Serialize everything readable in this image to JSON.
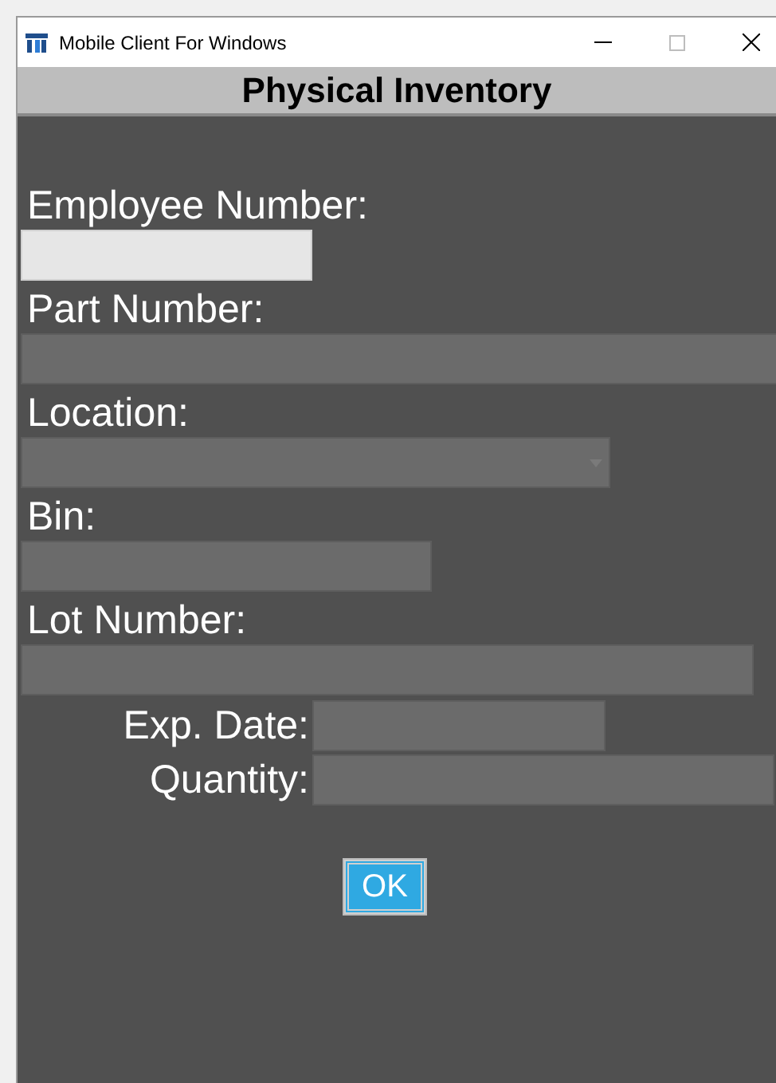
{
  "window": {
    "title": "Mobile Client For Windows"
  },
  "header": {
    "title": "Physical Inventory"
  },
  "fields": [
    {
      "label": "Employee Number:",
      "kind": "text",
      "disabled": false
    },
    {
      "label": "Part Number:",
      "kind": "text",
      "disabled": true
    },
    {
      "label": "Location:",
      "kind": "dropdown",
      "disabled": true
    },
    {
      "label": "Bin:",
      "kind": "text",
      "disabled": true
    },
    {
      "label": "Lot Number:",
      "kind": "text",
      "disabled": true
    }
  ],
  "inline_fields": [
    {
      "label": "Exp. Date:",
      "kind": "text",
      "disabled": true
    },
    {
      "label": "Quantity:",
      "kind": "text",
      "disabled": true
    }
  ],
  "buttons": [
    "OK"
  ]
}
